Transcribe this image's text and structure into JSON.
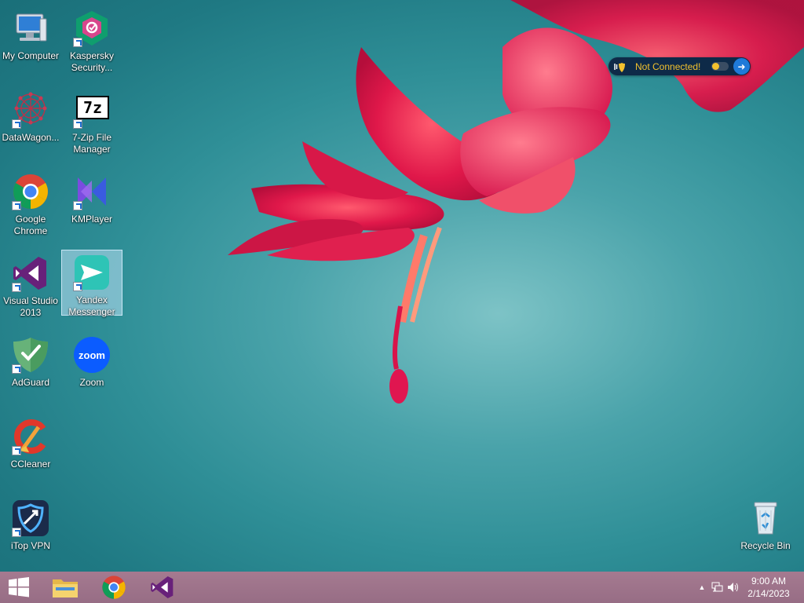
{
  "desktop": {
    "icons": [
      {
        "label": "My Computer",
        "icon": "my-computer-icon"
      },
      {
        "label": "Kaspersky Security...",
        "icon": "kaspersky-icon"
      },
      {
        "label": "DataWagon...",
        "icon": "datawagon-icon"
      },
      {
        "label": "7-Zip File Manager",
        "icon": "7zip-icon"
      },
      {
        "label": "Google Chrome",
        "icon": "chrome-icon"
      },
      {
        "label": "KMPlayer",
        "icon": "kmplayer-icon"
      },
      {
        "label": "Visual Studio 2013",
        "icon": "visual-studio-icon"
      },
      {
        "label": "Yandex Messenger",
        "icon": "yandex-messenger-icon",
        "selected": true
      },
      {
        "label": "AdGuard",
        "icon": "adguard-icon"
      },
      {
        "label": "Zoom",
        "icon": "zoom-icon"
      },
      {
        "label": "CCleaner",
        "icon": "ccleaner-icon"
      },
      {
        "label": "iTop VPN",
        "icon": "itop-vpn-icon"
      },
      {
        "label": "Recycle Bin",
        "icon": "recycle-bin-icon"
      }
    ],
    "sevenzip_logo": "7z",
    "zoom_logo": "zoom"
  },
  "vpn_widget": {
    "status": "Not Connected!",
    "status_color": "#f2c12e"
  },
  "taskbar": {
    "apps": [
      "start-icon",
      "file-explorer-icon",
      "chrome-icon",
      "visual-studio-icon"
    ],
    "tray": {
      "chevron": "▲",
      "time": "9:00 AM",
      "date": "2/14/2023"
    }
  }
}
